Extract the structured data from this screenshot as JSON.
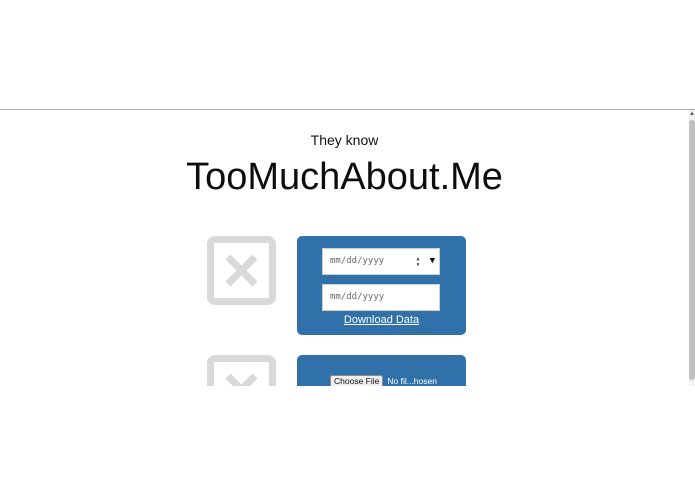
{
  "header": {
    "tagline": "They know",
    "site_title": "TooMuchAbout.Me"
  },
  "date_card": {
    "start_date_placeholder": "mm/dd/yyyy",
    "end_date_placeholder": "mm/dd/yyyy",
    "download_label": "Download Data"
  },
  "upload_card": {
    "choose_file_label": "Choose File",
    "file_status": "No fil...hosen"
  },
  "icons": {
    "placeholder": "broken-image-x-icon",
    "spin": "spin-arrows-icon",
    "dropdown": "caret-down-icon"
  },
  "colors": {
    "card_background": "#3071a9",
    "placeholder_gray": "#d9d9d9"
  }
}
